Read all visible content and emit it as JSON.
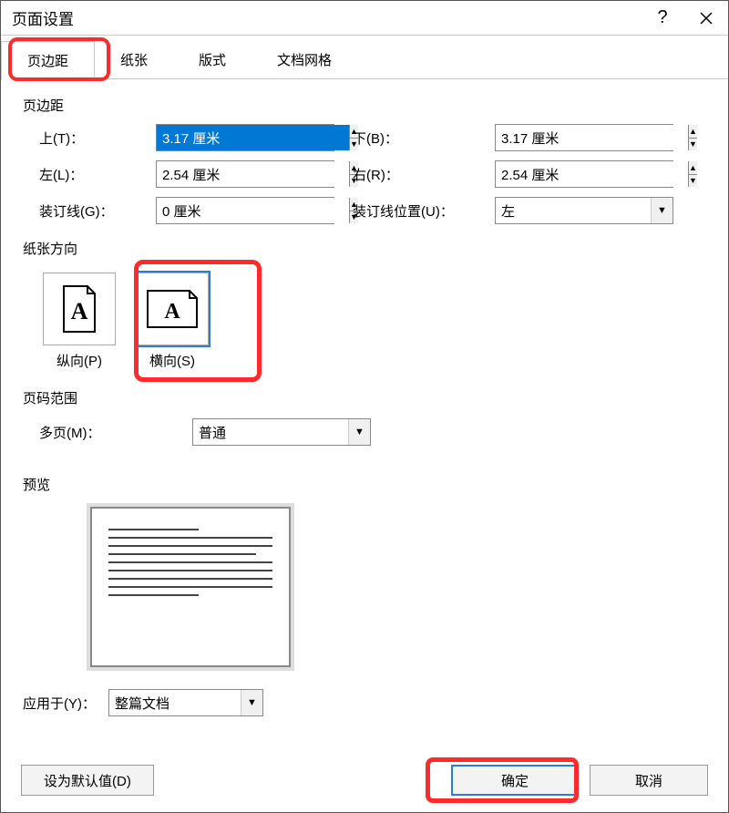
{
  "dialog": {
    "title": "页面设置"
  },
  "tabs": {
    "margins": "页边距",
    "paper": "纸张",
    "layout": "版式",
    "docgrid": "文档网格"
  },
  "groups": {
    "margins_title": "页边距",
    "orientation_title": "纸张方向",
    "pagerange_title": "页码范围",
    "preview_title": "预览"
  },
  "margins": {
    "top_label": "上(T)：",
    "top_value": "3.17 厘米",
    "bottom_label": "下(B)：",
    "bottom_value": "3.17 厘米",
    "left_label": "左(L)：",
    "left_value": "2.54 厘米",
    "right_label": "右(R)：",
    "right_value": "2.54 厘米",
    "gutter_label": "装订线(G)：",
    "gutter_value": "0 厘米",
    "gutterpos_label": "装订线位置(U)：",
    "gutterpos_value": "左"
  },
  "orientation": {
    "portrait_label": "纵向(P)",
    "landscape_label": "横向(S)"
  },
  "pagerange": {
    "multi_label": "多页(M)：",
    "multi_value": "普通"
  },
  "apply": {
    "label": "应用于(Y)：",
    "value": "整篇文档"
  },
  "footer": {
    "setdefault": "设为默认值(D)",
    "ok": "确定",
    "cancel": "取消"
  }
}
